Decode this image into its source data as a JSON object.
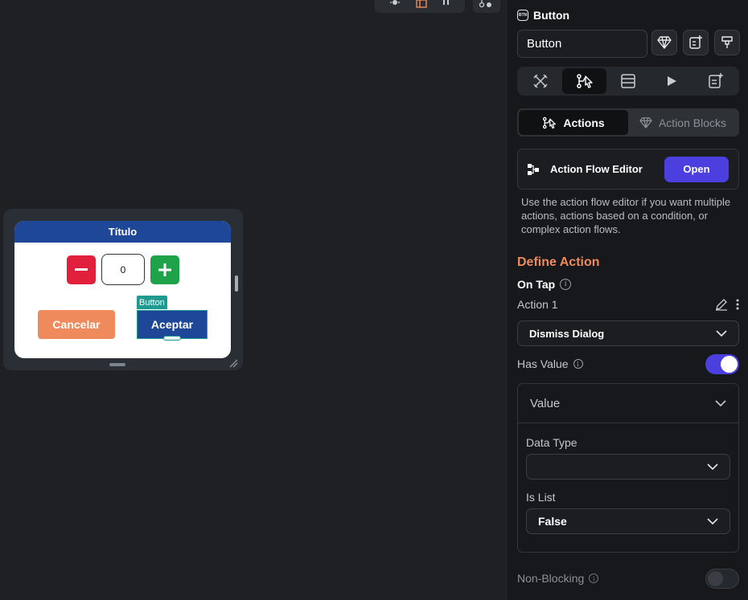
{
  "canvas": {
    "dialog": {
      "title": "Título",
      "counter_value": "0",
      "cancel_label": "Cancelar",
      "accept_label": "Aceptar",
      "selection_tag": "Button"
    }
  },
  "panel": {
    "widget_type": "Button",
    "widget_badge": "BTN",
    "name_value": "Button",
    "segments": {
      "actions": "Actions",
      "action_blocks": "Action Blocks"
    },
    "action_flow_editor": {
      "label": "Action Flow Editor",
      "open_label": "Open"
    },
    "helper_text": "Use the action flow editor if you want multiple actions, actions based on a condition, or complex action flows.",
    "define_action_title": "Define Action",
    "trigger_label": "On Tap",
    "action_label": "Action 1",
    "action_type": "Dismiss Dialog",
    "has_value_label": "Has Value",
    "has_value_on": true,
    "value_section": {
      "title": "Value",
      "data_type_label": "Data Type",
      "data_type_value": "",
      "is_list_label": "Is List",
      "is_list_value": "False"
    },
    "non_blocking_label": "Non-Blocking",
    "non_blocking_on": false
  },
  "colors": {
    "accent": "#4b3fe0",
    "section_title": "#ee8a5c",
    "dialog_header": "#1f4797",
    "minus_button": "#e0203d",
    "plus_button": "#1fa34a",
    "cancel_button": "#ee8a5c",
    "selection": "#1f9a90"
  }
}
